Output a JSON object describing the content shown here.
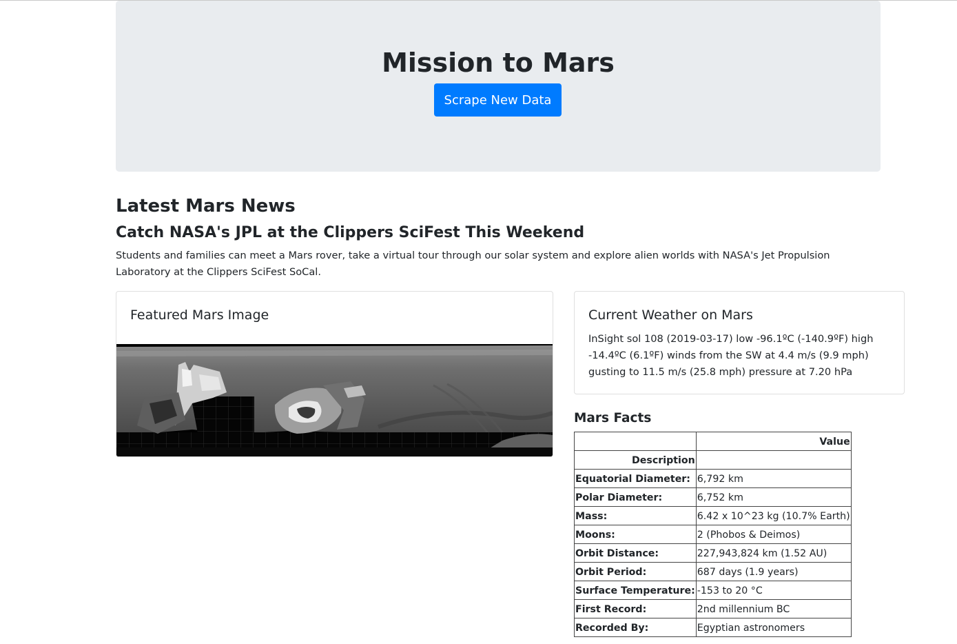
{
  "jumbotron": {
    "title": "Mission to Mars",
    "button_label": "Scrape New Data"
  },
  "news": {
    "heading": "Latest Mars News",
    "title": "Catch NASA's JPL at the Clippers SciFest This Weekend",
    "paragraph": "Students and families can meet a Mars rover, take a virtual tour through our solar system and explore alien worlds with NASA's Jet Propulsion Laboratory at the Clippers SciFest SoCal."
  },
  "featured_image": {
    "heading": "Featured Mars Image"
  },
  "weather": {
    "heading": "Current Weather on Mars",
    "text": "InSight sol 108 (2019-03-17) low -96.1ºC (-140.9ºF) high -14.4ºC (6.1ºF) winds from the SW at 4.4 m/s (9.9 mph) gusting to 11.5 m/s (25.8 mph) pressure at 7.20 hPa"
  },
  "facts": {
    "heading": "Mars Facts",
    "header_value": "Value",
    "index_label": "Description",
    "rows": [
      {
        "label": "Equatorial Diameter:",
        "value": "6,792 km"
      },
      {
        "label": "Polar Diameter:",
        "value": "6,752 km"
      },
      {
        "label": "Mass:",
        "value": "6.42 x 10^23 kg (10.7% Earth)"
      },
      {
        "label": "Moons:",
        "value": "2 (Phobos & Deimos)"
      },
      {
        "label": "Orbit Distance:",
        "value": "227,943,824 km (1.52 AU)"
      },
      {
        "label": "Orbit Period:",
        "value": "687 days (1.9 years)"
      },
      {
        "label": "Surface Temperature:",
        "value": "-153 to 20 °C"
      },
      {
        "label": "First Record:",
        "value": "2nd millennium BC"
      },
      {
        "label": "Recorded By:",
        "value": "Egyptian astronomers"
      }
    ]
  },
  "colors": {
    "jumbotron_bg": "#e9ecef",
    "primary_button": "#007bff"
  }
}
